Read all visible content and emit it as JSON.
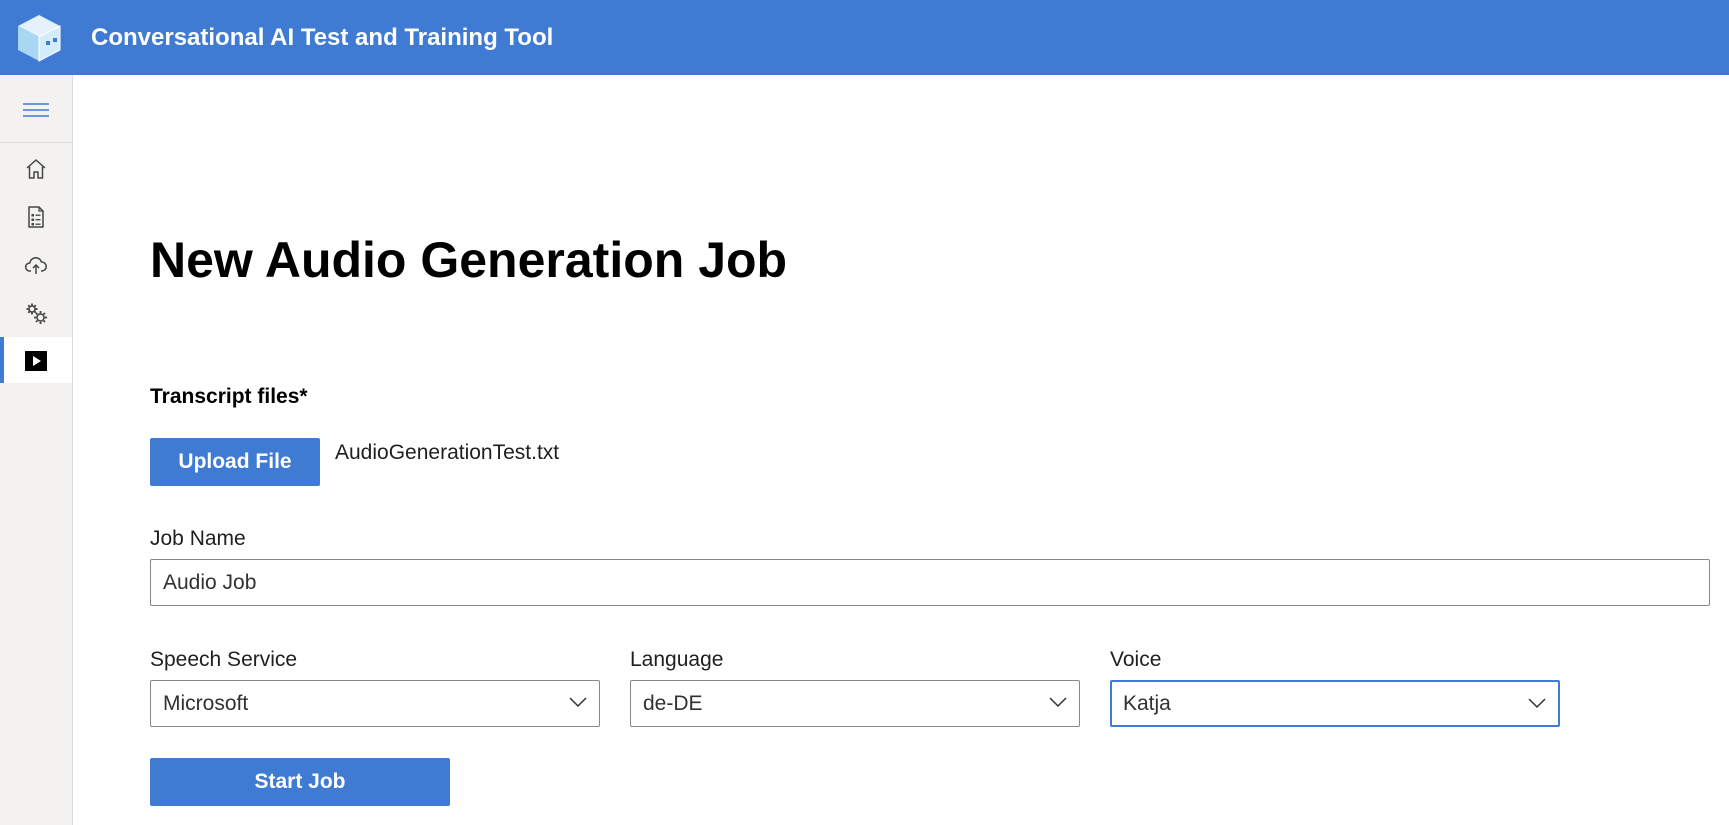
{
  "header": {
    "app_title": "Conversational AI Test and Training Tool",
    "color": "#3f7bd3"
  },
  "sidebar": {
    "items": [
      {
        "icon": "home-icon"
      },
      {
        "icon": "document-list-icon"
      },
      {
        "icon": "cloud-upload-icon"
      },
      {
        "icon": "gears-icon"
      },
      {
        "icon": "play-icon",
        "active": true
      }
    ]
  },
  "main": {
    "title": "New Audio Generation Job",
    "transcript": {
      "label": "Transcript files*",
      "upload_label": "Upload File",
      "file_name": "AudioGenerationTest.txt"
    },
    "job_name": {
      "label": "Job Name",
      "value": "Audio Job"
    },
    "speech_service": {
      "label": "Speech Service",
      "value": "Microsoft"
    },
    "language": {
      "label": "Language",
      "value": "de-DE"
    },
    "voice": {
      "label": "Voice",
      "value": "Katja"
    },
    "start_label": "Start Job"
  }
}
